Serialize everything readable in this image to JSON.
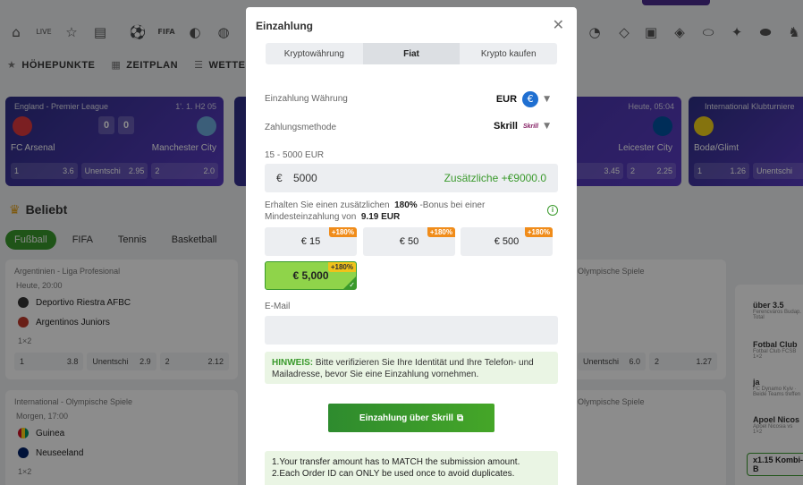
{
  "background": {
    "subnav": [
      {
        "icon": "star-icon",
        "label": "HÖHEPUNKTE"
      },
      {
        "icon": "calendar-icon",
        "label": "ZEITPLAN"
      },
      {
        "icon": "list-icon",
        "label": "WETTEN F"
      }
    ],
    "match_cards": [
      {
        "league": "England - Premier League",
        "time": "1'. 1. H2 05",
        "team1": "FC Arsenal",
        "team2": "Manchester City",
        "score1": "0",
        "score2": "0",
        "odds": [
          {
            "k": "1",
            "v": "3.6"
          },
          {
            "k": "Unentschi",
            "v": "2.95"
          },
          {
            "k": "2",
            "v": "2.0"
          }
        ]
      },
      {
        "league": "",
        "time": "Heute, 05:04",
        "team1": "",
        "team2": "Leicester City",
        "score1": "",
        "score2": "",
        "odds": [
          {
            "k": "",
            "v": "3.45"
          },
          {
            "k": "2",
            "v": "2.25"
          }
        ]
      },
      {
        "league": "International Klubturniere",
        "time": "",
        "team1": "Bodø/Glimt",
        "team2": "",
        "score1": "",
        "score2": "",
        "odds": [
          {
            "k": "1",
            "v": "1.26"
          },
          {
            "k": "Unentschi",
            "v": ""
          }
        ]
      }
    ],
    "popular_title": "Beliebt",
    "sport_tabs": [
      "Fußball",
      "FIFA",
      "Tennis",
      "Basketball"
    ],
    "events": [
      {
        "league": "Argentinien - Liga Profesional",
        "time": "Heute, 20:00",
        "team1": "Deportivo Riestra AFBC",
        "team2": "Argentinos Juniors",
        "type": "1×2",
        "odds": [
          {
            "k": "1",
            "v": "3.8"
          },
          {
            "k": "Unentschi",
            "v": "2.9"
          },
          {
            "k": "2",
            "v": "2.12"
          }
        ]
      },
      {
        "league": "International - Olympische Spiele",
        "time": "Morgen, 17:00",
        "team1": "Guinea",
        "team2": "Neuseeland",
        "type": "1×2"
      }
    ],
    "right_events": [
      {
        "league": "Olympische Spiele",
        "odds": [
          {
            "k": "Unentschi",
            "v": "6.0"
          },
          {
            "k": "2",
            "v": "1.27"
          }
        ]
      },
      {
        "league": "Olympische Spiele"
      }
    ],
    "side_items": [
      {
        "title": "über 3.5",
        "sub": "Ferencváros Budap. Total"
      },
      {
        "title": "Fotbal Club",
        "sub": "Fotbal Club FCSB 1×2"
      },
      {
        "title": "ja",
        "sub": "FC Dynamo Kyiv · Beide Teams treffen"
      },
      {
        "title": "Apoel Nicos",
        "sub": "Apoel Nicosia vs 1×2"
      }
    ],
    "combi": "x1.15 Kombi-B"
  },
  "modal": {
    "title": "Einzahlung",
    "tabs": [
      "Kryptowährung",
      "Fiat",
      "Krypto kaufen"
    ],
    "currency_label": "Einzahlung Währung",
    "currency_value": "EUR",
    "currency_symbol": "€",
    "method_label": "Zahlungsmethode",
    "method_value": "Skrill",
    "method_logo": "Skrill",
    "range": "15 - 5000 EUR",
    "amount_symbol": "€",
    "amount": "5000",
    "bonus_extra": "Zusätzliche +€9000.0",
    "bonus_text_1": "Erhalten Sie einen zusätzlichen",
    "bonus_pct": "180%",
    "bonus_text_2": "-Bonus bei einer Mindesteinzahlung von",
    "bonus_min": "9.19 EUR",
    "presets": [
      {
        "label": "€ 15",
        "tag": "+180%"
      },
      {
        "label": "€ 50",
        "tag": "+180%"
      },
      {
        "label": "€ 500",
        "tag": "+180%"
      },
      {
        "label": "€ 5,000",
        "tag": "+180%",
        "selected": true
      }
    ],
    "email_label": "E-Mail",
    "email_value": "",
    "notice_bold": "HINWEIS:",
    "notice_text": "Bitte verifizieren Sie Ihre Identität und Ihre Telefon- und Mailadresse, bevor Sie eine Einzahlung vornehmen.",
    "pay_button": "Einzahlung über Skrill",
    "rules": [
      "1.Your transfer amount has to MATCH the submission amount.",
      "2.Each Order ID can ONLY be used once to avoid duplicates."
    ]
  }
}
